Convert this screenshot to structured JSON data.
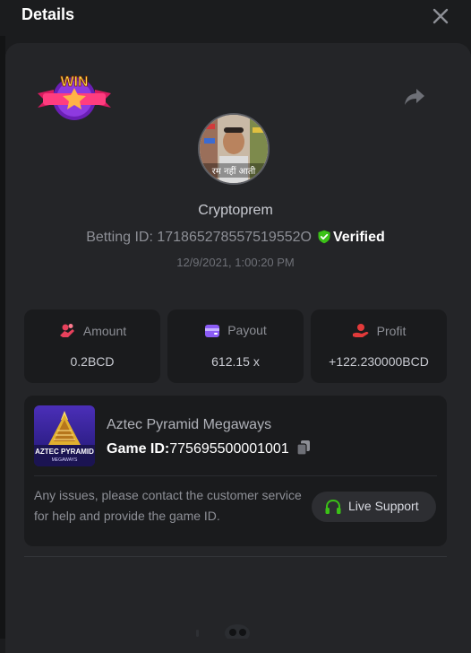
{
  "header": {
    "title": "Details"
  },
  "badge": {
    "text": "WIN"
  },
  "player": {
    "name": "Cryptoprem",
    "avatar_caption": "रम नहीं आती"
  },
  "bet": {
    "id_text": "Betting ID: 171865278557519552O",
    "verified_label": "Verified",
    "datetime": "12/9/2021, 1:00:20 PM"
  },
  "stats": {
    "amount": {
      "label": "Amount",
      "value": "0.2BCD",
      "icon": "coins-hand-icon",
      "color": "#e8415c"
    },
    "payout": {
      "label": "Payout",
      "value": "612.15 x",
      "icon": "wallet-card-icon",
      "color": "#8b5cf6"
    },
    "profit": {
      "label": "Profit",
      "value": "+122.230000BCD",
      "icon": "hand-coin-icon",
      "color": "#e23a3a"
    }
  },
  "game": {
    "name": "Aztec Pyramid Megaways",
    "id_label": "Game ID:",
    "id_value": "775695500001001",
    "thumb_title": "AZTEC PYRAMID",
    "thumb_sub": "MEGAWAYS"
  },
  "support": {
    "text": "Any issues, please contact the customer service for help and provide the game ID.",
    "button_label": "Live Support",
    "icon": "headset-icon",
    "color": "#3bc117"
  },
  "colors": {
    "background": "#1b1c1e",
    "panel": "#242528",
    "card": "#1a1b1d",
    "verified_green": "#3bc117"
  }
}
